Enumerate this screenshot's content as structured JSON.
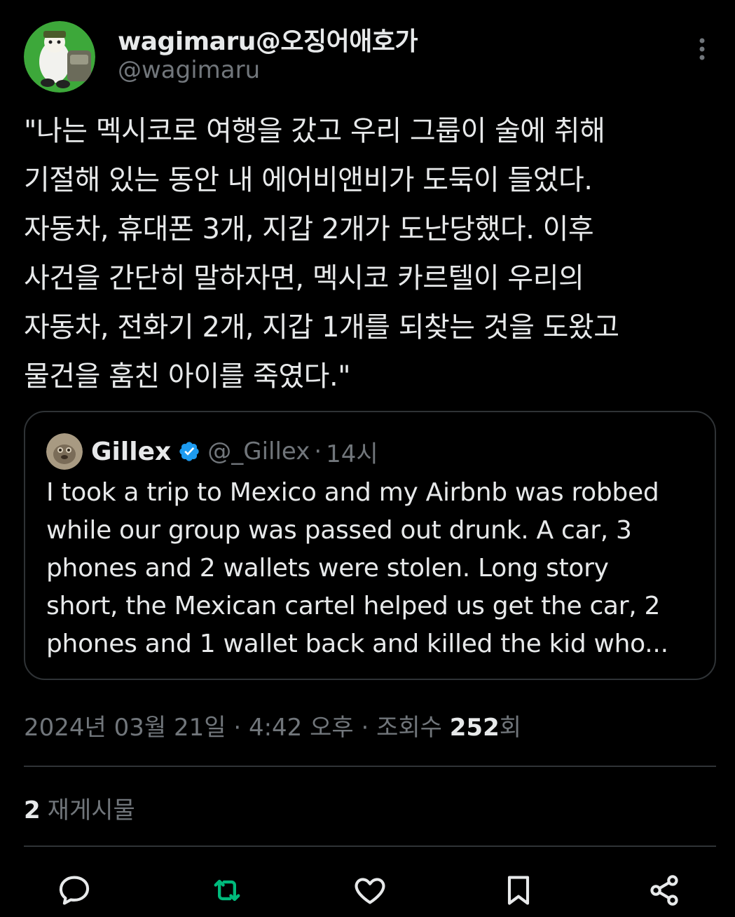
{
  "author": {
    "display_name": "wagimaru@오징어애호가",
    "handle": "@wagimaru"
  },
  "post": {
    "lines": [
      "\"나는 멕시코로 여행을 갔고 우리 그룹이 술에 취해",
      "기절해 있는 동안 내 에어비앤비가 도둑이 들었다.",
      "자동차, 휴대폰 3개, 지갑 2개가 도난당했다. 이후",
      "사건을 간단히 말하자면, 멕시코 카르텔이 우리의",
      "자동차, 전화기 2개, 지갑 1개를 되찾는 것을 도왔고",
      "물건을 훔친 아이를 죽였다.\""
    ]
  },
  "quoted": {
    "name": "Gillex",
    "handle": "@_Gillex",
    "separator": "·",
    "time": "14시",
    "verified": true,
    "lines": [
      "I took a trip to Mexico and my Airbnb was robbed",
      "while our group was passed out drunk. A car, 3",
      "phones and 2 wallets were stolen. Long story",
      "short, the Mexican cartel helped us get the car, 2",
      "phones and 1 wallet back and killed the kid who..."
    ]
  },
  "meta": {
    "date": "2024년 03월 21일",
    "sep1": "·",
    "time": "4:42 오후",
    "sep2": "·",
    "views_label": "조회수",
    "views_count": "252",
    "views_suffix": "회"
  },
  "reposts": {
    "count": "2",
    "label": "재게시물"
  },
  "actions": {
    "icons": [
      "reply-icon",
      "repost-icon",
      "like-icon",
      "bookmark-icon",
      "share-icon"
    ]
  },
  "colors": {
    "background": "#000000",
    "text_primary": "#e7e9ea",
    "text_secondary": "#71767b",
    "border": "#2f3336",
    "repost_green": "#00ba7c",
    "verified_blue": "#1d9bf0"
  }
}
